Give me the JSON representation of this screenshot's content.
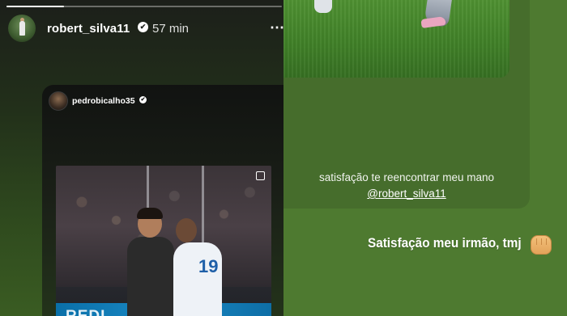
{
  "left_story": {
    "progress": 0.21,
    "header": {
      "username": "robert_silva11",
      "verified_badge": "✔",
      "time_ago": "57 min",
      "more_icon": "⋯"
    },
    "shared_post": {
      "username": "pedrobicalho35",
      "verified_badge": "✔",
      "photo_banner_text": "REDI",
      "jersey_number": "19"
    }
  },
  "right_story": {
    "caption_line": "satisfação te reencontrar meu mano",
    "mention": "@robert_silva11",
    "reply": "Satisfação meu irmão,  tmj"
  },
  "colors": {
    "right_bg": "#4e7a30",
    "left_bg_top": "#1c1f1a",
    "banner_blue": "#1a8ac6"
  },
  "icons": {
    "more": "more-options-icon",
    "verified": "verified-badge-icon",
    "gallery": "gallery-icon",
    "fist": "fist-bump-emoji-icon"
  }
}
